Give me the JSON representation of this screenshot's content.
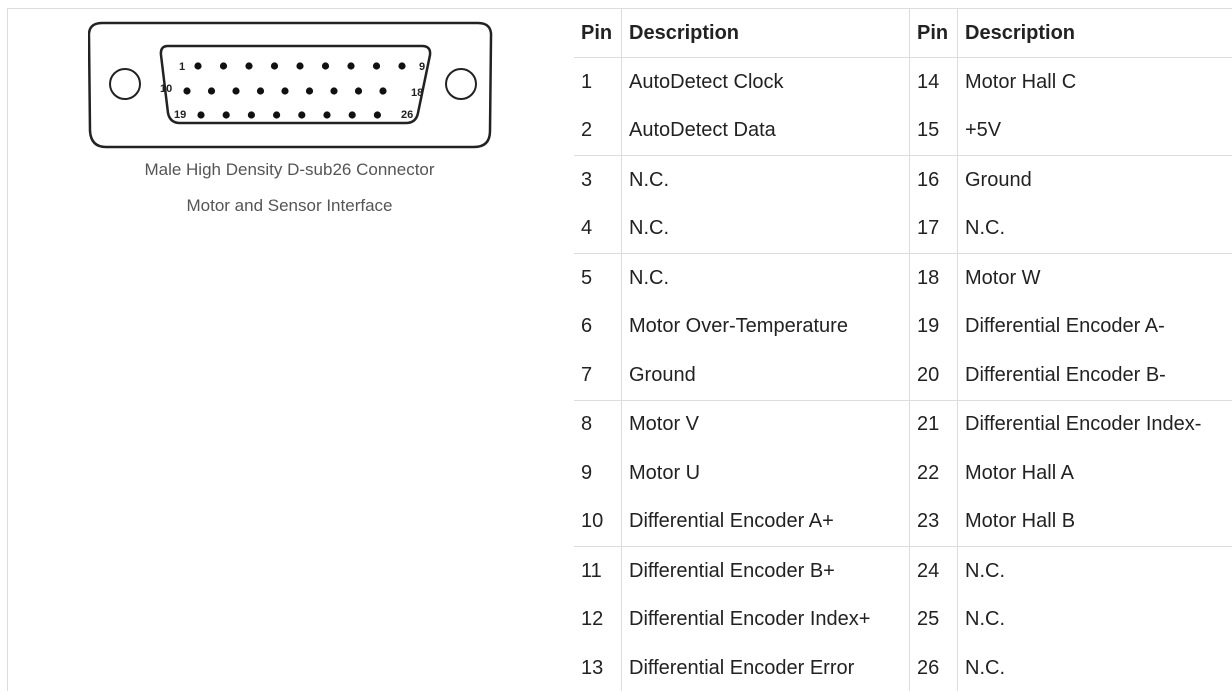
{
  "figure": {
    "caption_line1": "Male High Density D-sub26 Connector",
    "caption_line2": "Motor and Sensor Interface",
    "pin_labels": {
      "top_left": "1",
      "top_right": "9",
      "mid_left": "10",
      "mid_right": "18",
      "bottom_left": "19",
      "bottom_right": "26"
    }
  },
  "table": {
    "headers": [
      "Pin",
      "Description",
      "Pin",
      "Description"
    ],
    "rows": [
      [
        "1",
        "AutoDetect Clock",
        "14",
        "Motor Hall C"
      ],
      [
        "2",
        "AutoDetect Data",
        "15",
        "+5V"
      ],
      [
        "3",
        "N.C.",
        "16",
        "Ground"
      ],
      [
        "4",
        "N.C.",
        "17",
        "N.C."
      ],
      [
        "5",
        "N.C.",
        "18",
        "Motor W"
      ],
      [
        "6",
        "Motor Over-Temperature",
        "19",
        "Differential Encoder A-"
      ],
      [
        "7",
        "Ground",
        "20",
        "Differential Encoder B-"
      ],
      [
        "8",
        "Motor V",
        "21",
        "Differential Encoder Index-"
      ],
      [
        "9",
        "Motor U",
        "22",
        "Motor Hall A"
      ],
      [
        "10",
        "Differential Encoder A+",
        "23",
        "Motor Hall B"
      ],
      [
        "11",
        "Differential Encoder B+",
        "24",
        "N.C."
      ],
      [
        "12",
        "Differential Encoder Index+",
        "25",
        "N.C."
      ],
      [
        "13",
        "Differential Encoder Error",
        "26",
        "N.C."
      ]
    ]
  }
}
